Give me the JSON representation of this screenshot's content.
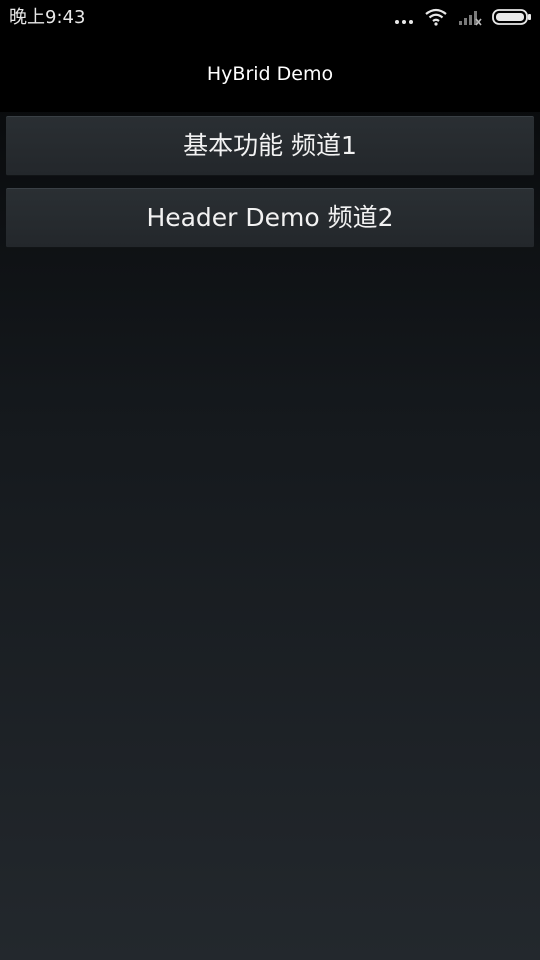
{
  "status_bar": {
    "time": "晚上9:43",
    "icons": [
      "more-dots-icon",
      "wifi-icon",
      "cell-signal-icon",
      "battery-icon"
    ]
  },
  "header": {
    "title": "HyBrid Demo"
  },
  "menu": {
    "items": [
      {
        "label": "基本功能 频道1"
      },
      {
        "label": "Header Demo 频道2"
      }
    ]
  },
  "colors": {
    "background_top": "#000000",
    "background_bottom": "#23282d",
    "button": "#282d31",
    "text": "#ffffff"
  }
}
